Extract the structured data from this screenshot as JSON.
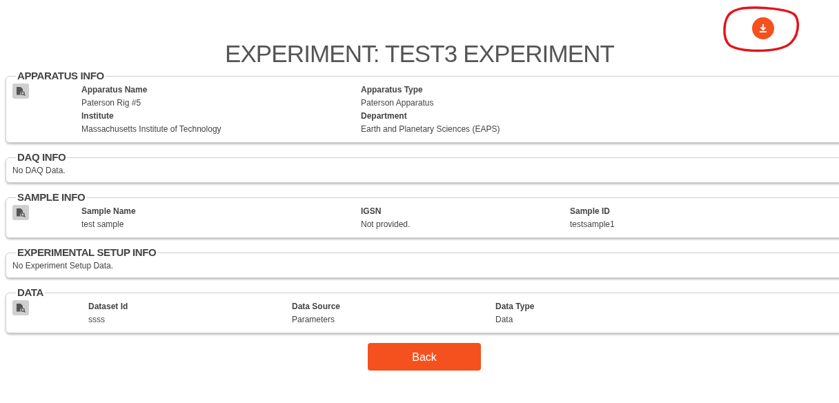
{
  "download_button": {
    "annotated": true
  },
  "title": "EXPERIMENT: TEST3 EXPERIMENT",
  "sections": [
    {
      "heading": "APPARATUS INFO",
      "kind": "fields",
      "columns": [
        [
          {
            "label": "Apparatus Name",
            "value": "Paterson Rig #5"
          },
          {
            "label": "Institute",
            "value": "Massachusetts Institute of Technology"
          }
        ],
        [
          {
            "label": "Apparatus Type",
            "value": "Paterson Apparatus"
          },
          {
            "label": "Department",
            "value": "Earth and Planetary Sciences (EAPS)"
          }
        ]
      ]
    },
    {
      "heading": "DAQ INFO",
      "kind": "message",
      "message": "No DAQ Data."
    },
    {
      "heading": "SAMPLE INFO",
      "kind": "fields",
      "columns": [
        [
          {
            "label": "Sample Name",
            "value": "test sample"
          }
        ],
        [
          {
            "label": "IGSN",
            "value": "Not provided."
          }
        ],
        [
          {
            "label": "Sample ID",
            "value": "testsample1"
          }
        ]
      ]
    },
    {
      "heading": "EXPERIMENTAL SETUP INFO",
      "kind": "message",
      "message": "No Experiment Setup Data."
    },
    {
      "heading": "DATA",
      "kind": "table",
      "columns": [
        [
          {
            "label": "Dataset Id",
            "value": "ssss"
          }
        ],
        [
          {
            "label": "Data Source",
            "value": "Parameters"
          }
        ],
        [
          {
            "label": "Data Type",
            "value": "Data"
          }
        ]
      ]
    }
  ],
  "back_button": "Back"
}
